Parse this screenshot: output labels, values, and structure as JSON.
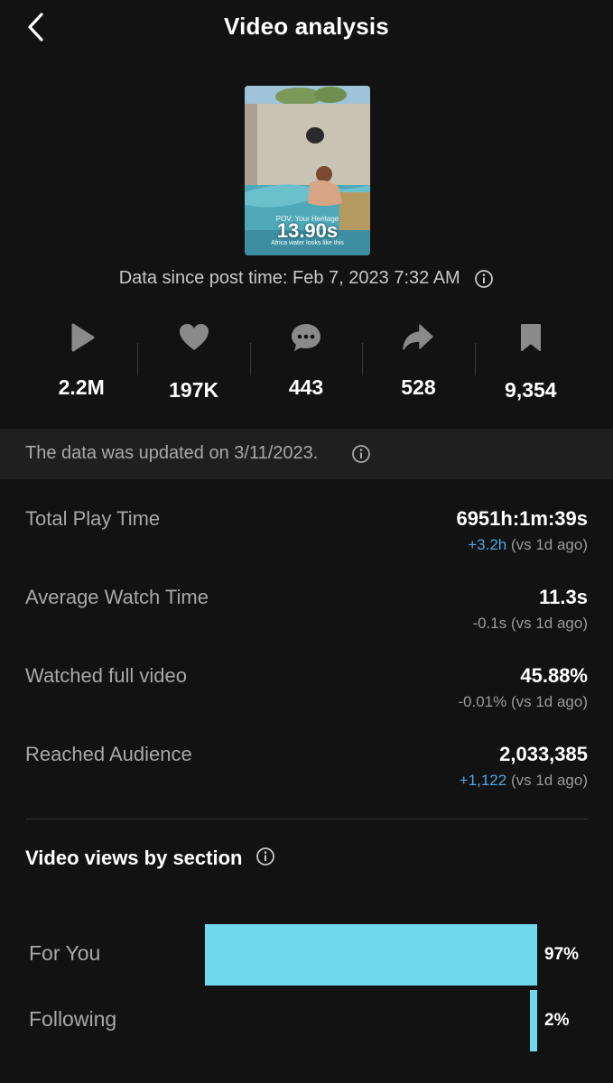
{
  "header": {
    "title": "Video analysis"
  },
  "thumbnail": {
    "caption_top": "POV: Your Heritage",
    "timer": "13.90s",
    "caption_bottom": "Africa water looks like this"
  },
  "post_time": "Data since post time: Feb 7, 2023 7:32 AM",
  "stats": [
    {
      "icon": "play-icon",
      "value": "2.2M"
    },
    {
      "icon": "heart-icon",
      "value": "197K"
    },
    {
      "icon": "comment-icon",
      "value": "443"
    },
    {
      "icon": "share-icon",
      "value": "528"
    },
    {
      "icon": "bookmark-icon",
      "value": "9,354"
    }
  ],
  "banner": {
    "text": "The data was updated on 3/11/2023."
  },
  "metrics": [
    {
      "label": "Total Play Time",
      "value": "6951h:1m:39s",
      "delta": "+3.2h",
      "delta_suffix": " (vs 1d ago)",
      "delta_positive": true
    },
    {
      "label": "Average Watch Time",
      "value": "11.3s",
      "delta": "-0.1s",
      "delta_suffix": " (vs 1d ago)",
      "delta_positive": false
    },
    {
      "label": "Watched full video",
      "value": "45.88%",
      "delta": "-0.01%",
      "delta_suffix": " (vs 1d ago)",
      "delta_positive": false
    },
    {
      "label": "Reached Audience",
      "value": "2,033,385",
      "delta": "+1,122",
      "delta_suffix": " (vs 1d ago)",
      "delta_positive": true
    }
  ],
  "section_views": {
    "title": "Video views by section",
    "bars": [
      {
        "label": "For You",
        "pct_label": "97%",
        "fraction": 0.97
      },
      {
        "label": "Following",
        "pct_label": "2%",
        "fraction": 0.02
      }
    ]
  },
  "colors": {
    "background": "#121212",
    "bar": "#6fd8ec",
    "positive_delta": "#4ea7e6"
  }
}
